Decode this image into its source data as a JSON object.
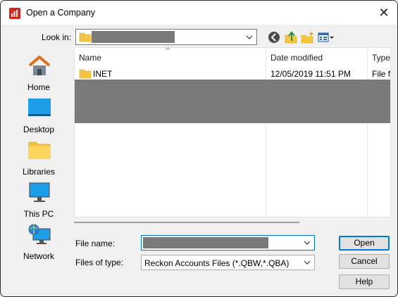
{
  "window": {
    "title": "Open a Company",
    "close_glyph": "✕"
  },
  "lookin": {
    "label": "Look in:",
    "value": "[redacted]"
  },
  "toolbar": {
    "icons": [
      "back-icon",
      "up-folder-icon",
      "new-folder-icon",
      "view-menu-icon"
    ]
  },
  "places": [
    {
      "label": "Home",
      "icon": "home-icon"
    },
    {
      "label": "Desktop",
      "icon": "desktop-icon"
    },
    {
      "label": "Libraries",
      "icon": "libraries-icon"
    },
    {
      "label": "This PC",
      "icon": "this-pc-icon"
    },
    {
      "label": "Network",
      "icon": "network-icon"
    }
  ],
  "filelist": {
    "columns": {
      "name": "Name",
      "date": "Date modified",
      "type": "Type"
    },
    "sort_glyph": "^",
    "rows": [
      {
        "name": "INET",
        "date": "12/05/2019 11:51 PM",
        "type": "File fo"
      }
    ],
    "redacted_rows": true
  },
  "filename": {
    "label": "File name:",
    "value": "[redacted]"
  },
  "filetype": {
    "label": "Files of type:",
    "value": "Reckon Accounts Files (*.QBW,*.QBA)"
  },
  "buttons": {
    "open": "Open",
    "cancel": "Cancel",
    "help": "Help"
  },
  "colors": {
    "accent": "#0078d7",
    "folder": "#f4c542",
    "redaction": "#7a7a7a"
  }
}
